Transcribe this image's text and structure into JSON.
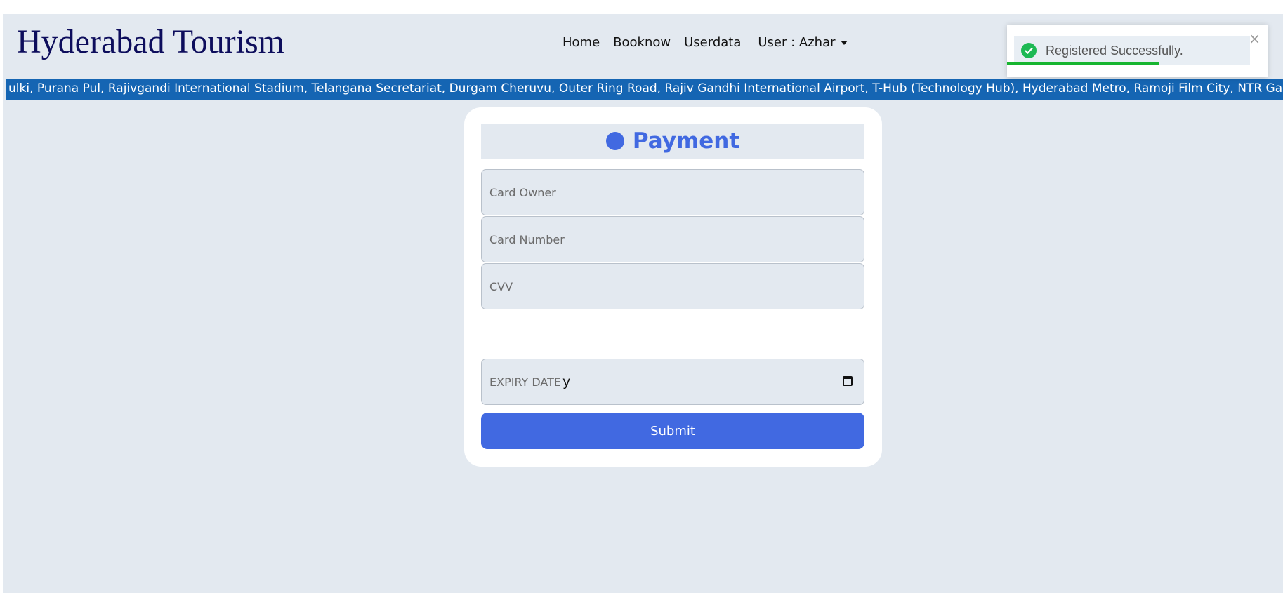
{
  "brand": "Hyderabad Tourism",
  "nav": {
    "home": "Home",
    "booknow": "Booknow",
    "userdata": "Userdata",
    "user": "User : Azhar"
  },
  "marquee": {
    "text": "ulki, Purana Pul, Rajivgandi International Stadium, Telangana Secretariat, Durgam Cheruvu, Outer Ring Road, Rajiv Gandhi International Airport, T-Hub (Technology Hub), Hyderabad Metro, Ramoji Film City, NTR Garden"
  },
  "payment": {
    "title": "Payment",
    "card_owner_placeholder": "Card Owner",
    "card_number_placeholder": "Card Number",
    "cvv_placeholder": "CVV",
    "expiry_placeholder": "EXPIRY DATE",
    "expiry_value": "y",
    "submit_label": "Submit"
  },
  "toast": {
    "message": "Registered Successfully.",
    "close": "×",
    "progress": 0.72,
    "accent": "#17b530"
  },
  "colors": {
    "accent": "#4169e1",
    "brand": "#0d0d5c",
    "marquee": "#1565b3",
    "background": "#e3e9f0"
  }
}
